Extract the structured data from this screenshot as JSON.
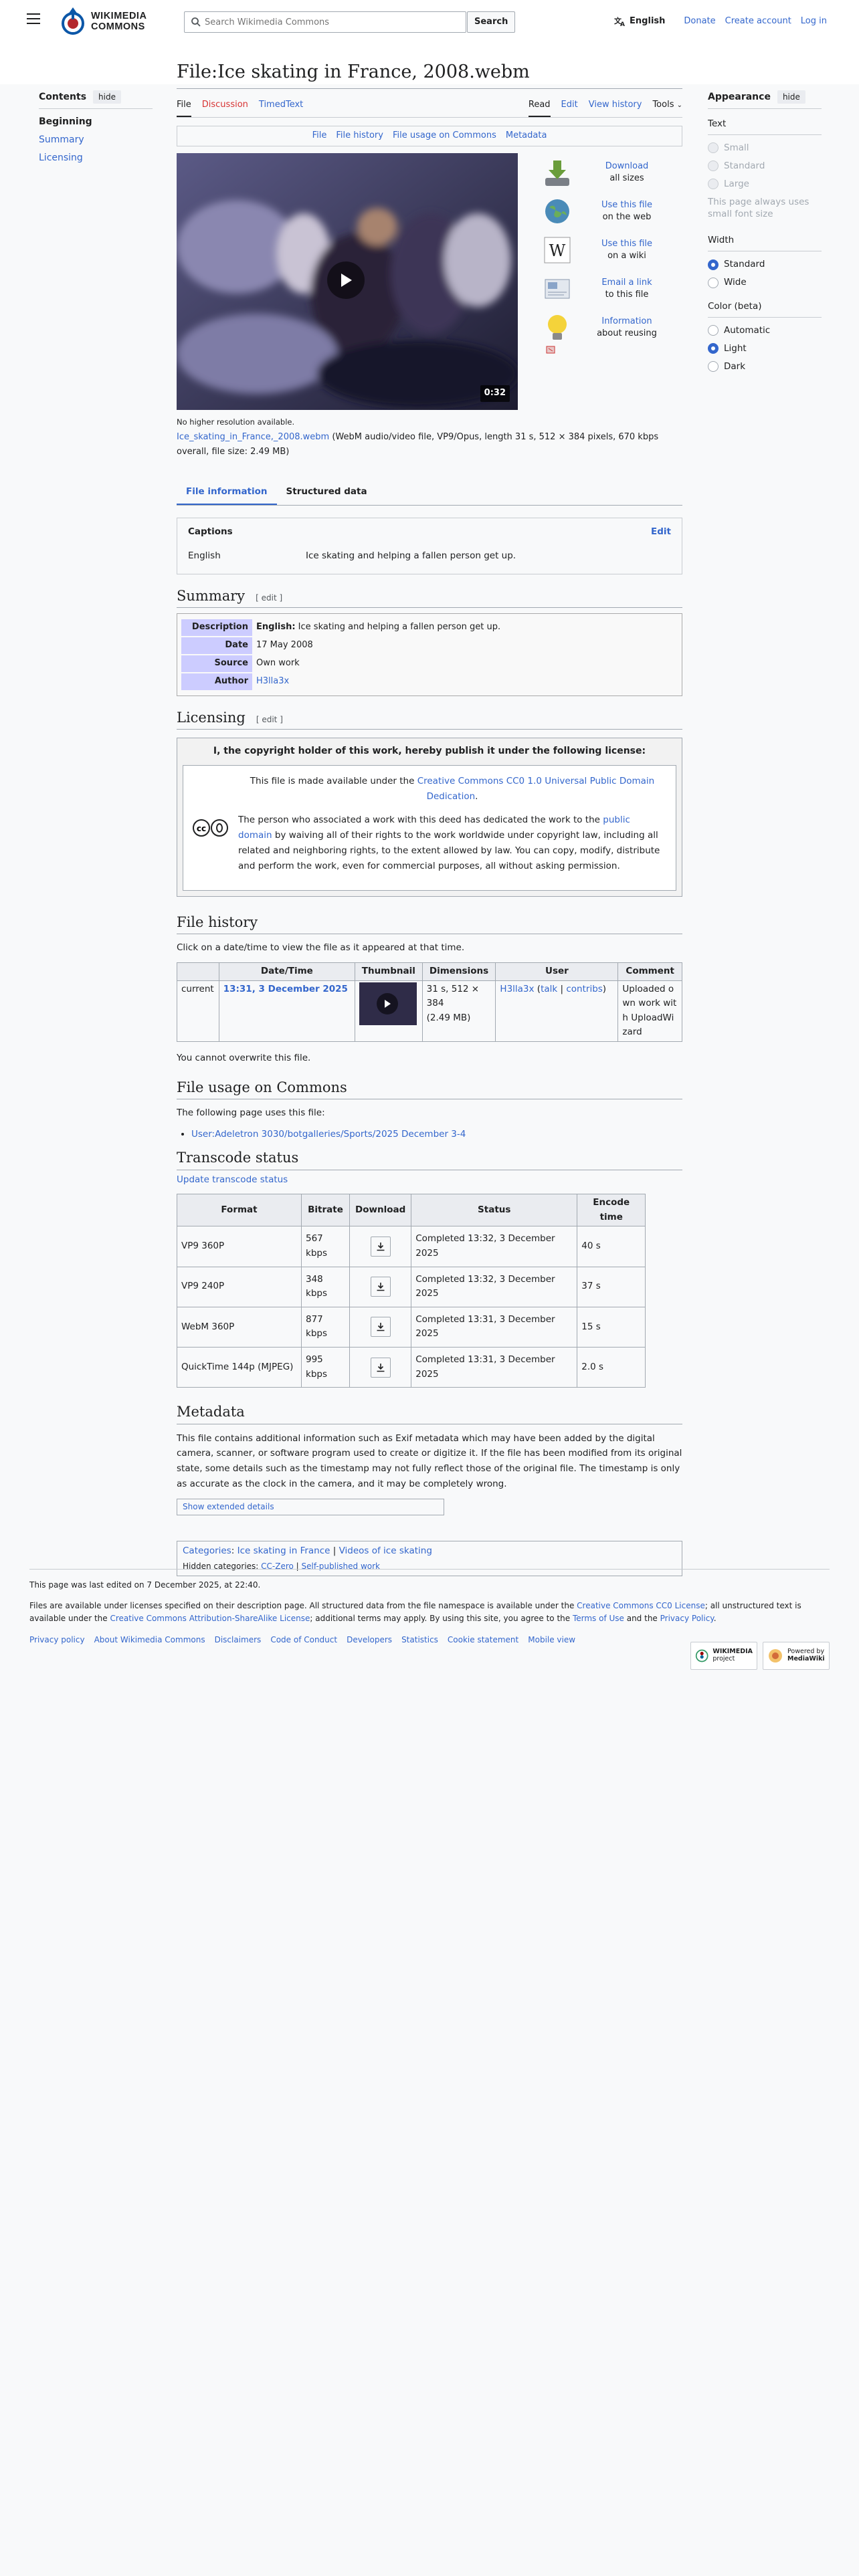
{
  "header": {
    "logo_line1": "WIKIMEDIA",
    "logo_line2": "COMMONS",
    "search_placeholder": "Search Wikimedia Commons",
    "search_button": "Search",
    "language": "English",
    "links": [
      "Donate",
      "Create account",
      "Log in"
    ]
  },
  "toc": {
    "title": "Contents",
    "hide": "hide",
    "items": [
      "Beginning",
      "Summary",
      "Licensing"
    ]
  },
  "page": {
    "title": "File:Ice skating in France, 2008.webm",
    "tabs_left": [
      "File",
      "Discussion",
      "TimedText"
    ],
    "tabs_right": [
      "Read",
      "Edit",
      "View history",
      "Tools"
    ],
    "file_toc": [
      "File",
      "File history",
      "File usage on Commons",
      "Metadata"
    ]
  },
  "media": {
    "duration": "0:32",
    "no_higher": "No higher resolution available.",
    "file_link": "Ice_skating_in_France,_2008.webm",
    "file_desc": " (WebM audio/video file, VP9/Opus, length 31 s, 512 × 384 pixels, 670 kbps overall, file size: 2.49 MB)",
    "actions": [
      {
        "link": "Download",
        "text": "all sizes"
      },
      {
        "link": "Use this file",
        "text": "on the web"
      },
      {
        "link": "Use this file",
        "text": "on a wiki"
      },
      {
        "link": "Email a link",
        "text": "to this file"
      },
      {
        "link": "Information",
        "text": "about reusing"
      }
    ]
  },
  "info_tabs": [
    "File information",
    "Structured data"
  ],
  "captions": {
    "title": "Captions",
    "edit": "Edit",
    "lang": "English",
    "text": "Ice skating and helping a fallen person get up."
  },
  "summary": {
    "heading": "Summary",
    "edit": "[ edit ]",
    "rows": [
      {
        "k": "Description",
        "lang": "English:",
        "v": " Ice skating and helping a fallen person get up."
      },
      {
        "k": "Date",
        "v": "17 May 2008"
      },
      {
        "k": "Source",
        "v": "Own work"
      },
      {
        "k": "Author",
        "v": "H3lla3x"
      }
    ]
  },
  "licensing": {
    "heading": "Licensing",
    "edit": "[ edit ]",
    "banner": "I, the copyright holder of this work, hereby publish it under the following license:",
    "p1_pre": "This file is made available under the ",
    "p1_link": "Creative Commons CC0 1.0 Universal Public Domain Dedication",
    "p1_post": ".",
    "p2_pre": "The person who associated a work with this deed has dedicated the work to the ",
    "p2_link": "public domain",
    "p2_post": " by waiving all of their rights to the work worldwide under copyright law, including all related and neighboring rights, to the extent allowed by law. You can copy, modify, distribute and perform the work, even for commercial purposes, all without asking permission."
  },
  "file_history": {
    "heading": "File history",
    "intro": "Click on a date/time to view the file as it appeared at that time.",
    "cols": [
      "",
      "Date/Time",
      "Thumbnail",
      "Dimensions",
      "User",
      "Comment"
    ],
    "row": {
      "current": "current",
      "datetime": "13:31, 3 December 2025",
      "dim1": "31 s, 512 ×",
      "dim2": "384",
      "dim3": "(2.49 MB)",
      "user": "H3lla3x",
      "talk": "talk",
      "contribs": "contribs",
      "comment": "Uploaded own work with UploadWizard"
    },
    "cannot": "You cannot overwrite this file."
  },
  "usage": {
    "heading": "File usage on Commons",
    "intro": "The following page uses this file:",
    "items": [
      "User:Adeletron 3030/botgalleries/Sports/2025 December 3-4"
    ]
  },
  "transcode": {
    "heading": "Transcode status",
    "update": "Update transcode status",
    "cols": [
      "Format",
      "Bitrate",
      "Download",
      "Status",
      "Encode time"
    ],
    "rows": [
      {
        "format": "VP9 360P",
        "bitrate": "567 kbps",
        "status": "Completed 13:32, 3 December 2025",
        "time": "40 s"
      },
      {
        "format": "VP9 240P",
        "bitrate": "348 kbps",
        "status": "Completed 13:32, 3 December 2025",
        "time": "37 s"
      },
      {
        "format": "WebM 360P",
        "bitrate": "877 kbps",
        "status": "Completed 13:31, 3 December 2025",
        "time": "15 s"
      },
      {
        "format": "QuickTime 144p (MJPEG)",
        "bitrate": "995 kbps",
        "status": "Completed 13:31, 3 December 2025",
        "time": "2.0 s"
      }
    ]
  },
  "metadata": {
    "heading": "Metadata",
    "text": "This file contains additional information such as Exif metadata which may have been added by the digital camera, scanner, or software program used to create or digitize it. If the file has been modified from its original state, some details such as the timestamp may not fully reflect those of the original file. The timestamp is only as accurate as the clock in the camera, and it may be completely wrong.",
    "button": "Show extended details"
  },
  "categories": {
    "label": "Categories",
    "items": [
      "Ice skating in France",
      "Videos of ice skating"
    ],
    "hidden_label": "Hidden categories: ",
    "hidden": [
      "CC-Zero",
      "Self-published work"
    ]
  },
  "footer": {
    "edited": "This page was last edited on 7 December 2025, at 22:40.",
    "lic_1": "Files are available under licenses specified on their description page. All structured data from the file namespace is available under the ",
    "lic_link1": "Creative Commons CC0 License",
    "lic_2": "; all unstructured text is available under the ",
    "lic_link2": "Creative Commons Attribution-ShareAlike License",
    "lic_3": "; additional terms may apply. By using this site, you agree to the ",
    "lic_link3": "Terms of Use",
    "lic_4": " and the ",
    "lic_link4": "Privacy Policy",
    "lic_5": ".",
    "links": [
      "Privacy policy",
      "About Wikimedia Commons",
      "Disclaimers",
      "Code of Conduct",
      "Developers",
      "Statistics",
      "Cookie statement",
      "Mobile view"
    ],
    "badge1": [
      "WIKIMEDIA",
      "project"
    ],
    "badge2": [
      "Powered by",
      "MediaWiki"
    ]
  },
  "appearance": {
    "title": "Appearance",
    "hide": "hide",
    "text_label": "Text",
    "text_opts": [
      "Small",
      "Standard",
      "Large"
    ],
    "text_note": "This page always uses small font size",
    "width_label": "Width",
    "width_opts": [
      "Standard",
      "Wide"
    ],
    "color_label": "Color (beta)",
    "color_opts": [
      "Automatic",
      "Light",
      "Dark"
    ]
  },
  "colors": {
    "link": "#3366cc",
    "red_link": "#d73333",
    "cc_header": "#ccccff"
  }
}
